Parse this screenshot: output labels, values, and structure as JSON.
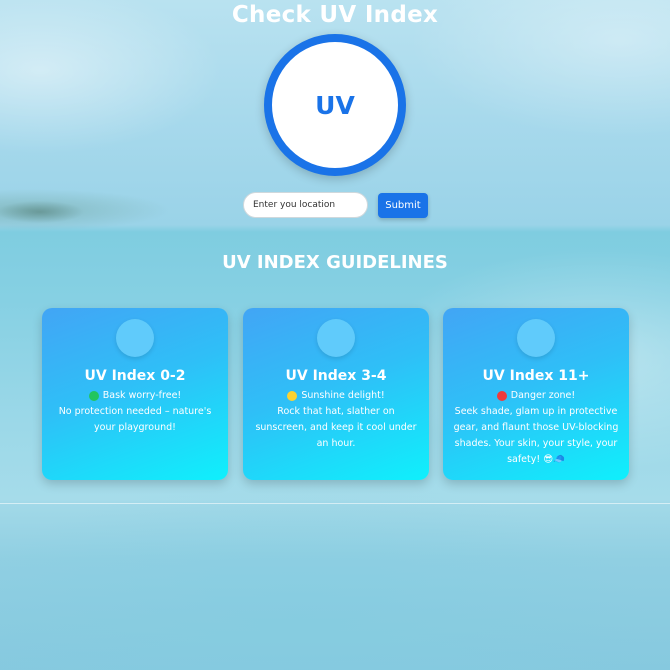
{
  "page": {
    "title": "Check UV Index",
    "uv_badge": "UV"
  },
  "search": {
    "placeholder": "Enter you location",
    "submit_label": "Submit"
  },
  "guidelines": {
    "heading": "UV INDEX GUIDELINES",
    "cards": [
      {
        "title": "UV Index 0-2",
        "status_color": "#22c55e",
        "status": "Bask worry-free!",
        "description": "No protection needed – nature's your playground!"
      },
      {
        "title": "UV Index 3-4",
        "status_color": "#fbd230",
        "status": "Sunshine delight!",
        "description": "Rock that hat, slather on sunscreen, and keep it cool under an hour."
      },
      {
        "title": "UV Index 11+",
        "status_color": "#ef3b3b",
        "status": "Danger zone!",
        "description": "Seek shade, glam up in protective gear, and flaunt those UV-blocking shades. Your skin, your style, your safety! 😎🧢"
      }
    ]
  },
  "colors": {
    "accent": "#1a73e8",
    "card_gradient_start": "#42a5f5",
    "card_gradient_end": "#0ff0fc"
  }
}
